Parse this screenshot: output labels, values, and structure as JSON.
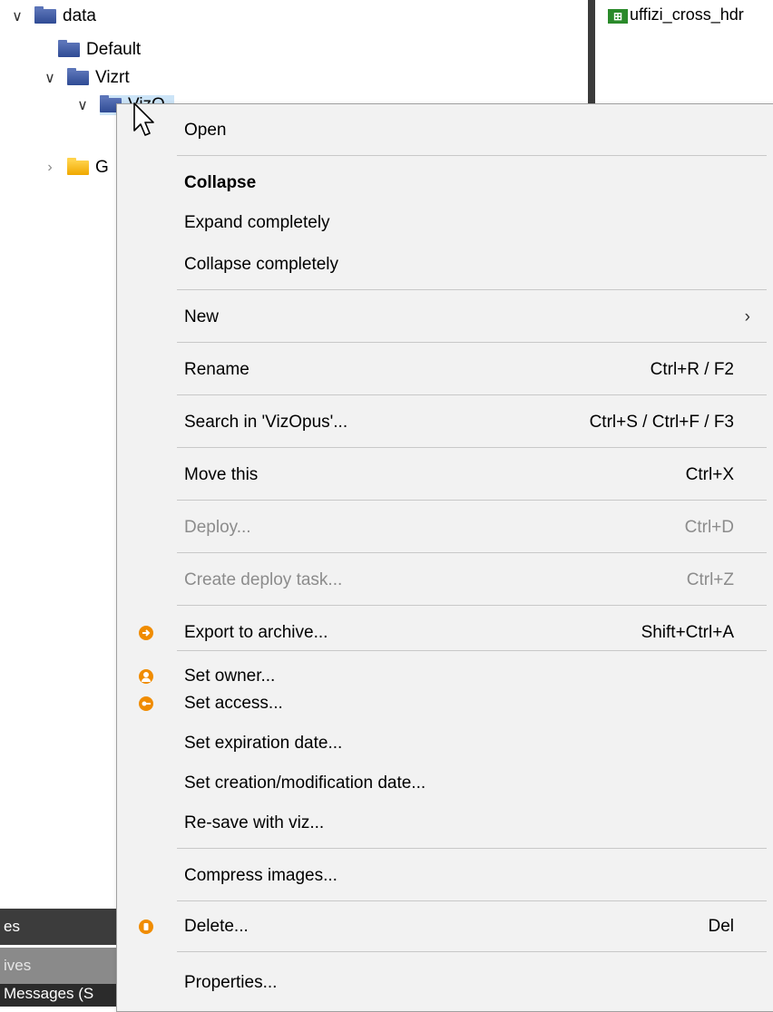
{
  "tree": {
    "items": [
      {
        "label": "data"
      },
      {
        "label": "Default"
      },
      {
        "label": "Vizrt"
      },
      {
        "label": "VizO"
      },
      {
        "label": "G"
      }
    ]
  },
  "right_panel": {
    "item_label": "uffizi_cross_hdr",
    "item_icon": "image-icon"
  },
  "bottom_tabs": {
    "tab1": "es",
    "tab2": "ives",
    "tab3": "Messages (S"
  },
  "menu": {
    "open": "Open",
    "collapse": "Collapse",
    "expand_completely": "Expand completely",
    "collapse_completely": "Collapse completely",
    "new": "New",
    "rename": "Rename",
    "rename_shortcut": "Ctrl+R / F2",
    "search": "Search in 'VizOpus'...",
    "search_shortcut": "Ctrl+S / Ctrl+F / F3",
    "move": "Move this",
    "move_shortcut": "Ctrl+X",
    "deploy": "Deploy...",
    "deploy_shortcut": "Ctrl+D",
    "create_deploy_task": "Create deploy task...",
    "create_deploy_task_shortcut": "Ctrl+Z",
    "export_archive": "Export to archive...",
    "export_archive_shortcut": "Shift+Ctrl+A",
    "set_owner": "Set owner...",
    "set_access": "Set access...",
    "set_expiration": "Set expiration date...",
    "set_creation": "Set creation/modification date...",
    "resave": "Re-save with viz...",
    "compress": "Compress images...",
    "delete": "Delete...",
    "delete_shortcut": "Del",
    "properties": "Properties..."
  },
  "colors": {
    "menu_bg": "#f2f2f2",
    "folder_blue": "#3f5aa6",
    "folder_yellow": "#f5b800",
    "icon_orange": "#f08c00",
    "selection": "#cce4f7",
    "disabled_text": "#8c8c8c"
  }
}
